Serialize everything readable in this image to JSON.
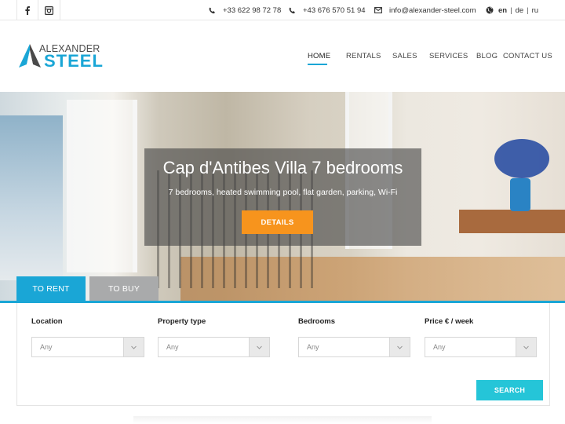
{
  "topbar": {
    "phone1": "+33 622 98 72 78",
    "phone2": "+43 676 570 51 94",
    "email": "info@alexander-steel.com",
    "lang": {
      "en": "en",
      "de": "de",
      "ru": "ru",
      "separator": "|"
    }
  },
  "logo": {
    "line1": "ALEXANDER",
    "line2": "STEEL"
  },
  "nav": {
    "home": "HOME",
    "rentals": "RENTALS",
    "sales": "SALES",
    "services": "SERVICES",
    "blog": "BLOG",
    "contact": "CONTACT US"
  },
  "hero": {
    "title": "Cap d'Antibes Villa 7 bedrooms",
    "subtitle": "7 bedrooms, heated swimming pool, flat garden, parking, Wi-Fi",
    "button": "DETAILS"
  },
  "tabs": {
    "rent": "TO RENT",
    "buy": "TO BUY"
  },
  "search": {
    "location_label": "Location",
    "location_value": "Any",
    "type_label": "Property type",
    "type_value": "Any",
    "bedrooms_label": "Bedrooms",
    "bedrooms_value": "Any",
    "price_label": "Price € / week",
    "price_value": "Any",
    "button": "SEARCH"
  },
  "colors": {
    "accent": "#1aa6d6",
    "orange": "#f7941d",
    "search": "#25c5d8",
    "tab_inactive": "#a9aaab"
  }
}
